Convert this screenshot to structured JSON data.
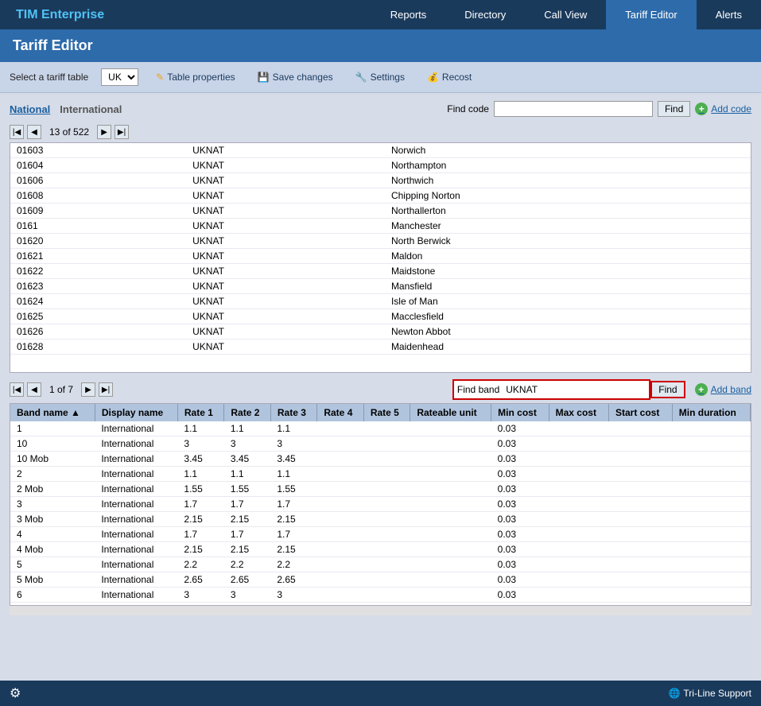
{
  "app": {
    "name_prefix": "TIM",
    "name_suffix": " Enterprise"
  },
  "nav": {
    "items": [
      {
        "label": "Reports",
        "active": false
      },
      {
        "label": "Directory",
        "active": false
      },
      {
        "label": "Call View",
        "active": false
      },
      {
        "label": "Tariff Editor",
        "active": true
      },
      {
        "label": "Alerts",
        "active": false
      }
    ]
  },
  "page_title": "Tariff Editor",
  "toolbar": {
    "select_label": "Select a tariff table",
    "tariff_options": [
      "UK"
    ],
    "tariff_selected": "UK",
    "table_properties": "Table properties",
    "save_changes": "Save changes",
    "settings": "Settings",
    "recost": "Recost"
  },
  "tabs": {
    "national_label": "National",
    "international_label": "International",
    "active": "National"
  },
  "find_code": {
    "label": "Find code",
    "placeholder": "",
    "button": "Find"
  },
  "add_code": {
    "label": "Add code"
  },
  "pagination_top": {
    "current": 13,
    "total": 522
  },
  "codes_table": {
    "rows": [
      {
        "code": "01603",
        "type": "UKNAT",
        "description": "Norwich"
      },
      {
        "code": "01604",
        "type": "UKNAT",
        "description": "Northampton"
      },
      {
        "code": "01606",
        "type": "UKNAT",
        "description": "Northwich"
      },
      {
        "code": "01608",
        "type": "UKNAT",
        "description": "Chipping Norton"
      },
      {
        "code": "01609",
        "type": "UKNAT",
        "description": "Northallerton"
      },
      {
        "code": "0161",
        "type": "UKNAT",
        "description": "Manchester"
      },
      {
        "code": "01620",
        "type": "UKNAT",
        "description": "North Berwick"
      },
      {
        "code": "01621",
        "type": "UKNAT",
        "description": "Maldon"
      },
      {
        "code": "01622",
        "type": "UKNAT",
        "description": "Maidstone"
      },
      {
        "code": "01623",
        "type": "UKNAT",
        "description": "Mansfield"
      },
      {
        "code": "01624",
        "type": "UKNAT",
        "description": "Isle of Man"
      },
      {
        "code": "01625",
        "type": "UKNAT",
        "description": "Macclesfield"
      },
      {
        "code": "01626",
        "type": "UKNAT",
        "description": "Newton Abbot"
      },
      {
        "code": "01628",
        "type": "UKNAT",
        "description": "Maidenhead"
      }
    ]
  },
  "pagination_band": {
    "current": 1,
    "total": 7
  },
  "find_band": {
    "label": "Find band",
    "value": "UKNAT",
    "button": "Find"
  },
  "add_band": {
    "label": "Add band"
  },
  "band_table": {
    "headers": [
      {
        "label": "Band name ▲",
        "sort": true
      },
      {
        "label": "Display name"
      },
      {
        "label": "Rate 1"
      },
      {
        "label": "Rate 2"
      },
      {
        "label": "Rate 3"
      },
      {
        "label": "Rate 4"
      },
      {
        "label": "Rate 5"
      },
      {
        "label": "Rateable unit"
      },
      {
        "label": "Min cost"
      },
      {
        "label": "Max cost"
      },
      {
        "label": "Start cost"
      },
      {
        "label": "Min duration"
      }
    ],
    "rows": [
      {
        "band": "1",
        "display": "International",
        "r1": "1.1",
        "r2": "1.1",
        "r3": "1.1",
        "r4": "",
        "r5": "",
        "rateable": "",
        "min_cost": "0.03",
        "max_cost": "",
        "start_cost": "",
        "min_dur": ""
      },
      {
        "band": "10",
        "display": "International",
        "r1": "3",
        "r2": "3",
        "r3": "3",
        "r4": "",
        "r5": "",
        "rateable": "",
        "min_cost": "0.03",
        "max_cost": "",
        "start_cost": "",
        "min_dur": ""
      },
      {
        "band": "10 Mob",
        "display": "International",
        "r1": "3.45",
        "r2": "3.45",
        "r3": "3.45",
        "r4": "",
        "r5": "",
        "rateable": "",
        "min_cost": "0.03",
        "max_cost": "",
        "start_cost": "",
        "min_dur": ""
      },
      {
        "band": "2",
        "display": "International",
        "r1": "1.1",
        "r2": "1.1",
        "r3": "1.1",
        "r4": "",
        "r5": "",
        "rateable": "",
        "min_cost": "0.03",
        "max_cost": "",
        "start_cost": "",
        "min_dur": ""
      },
      {
        "band": "2 Mob",
        "display": "International",
        "r1": "1.55",
        "r2": "1.55",
        "r3": "1.55",
        "r4": "",
        "r5": "",
        "rateable": "",
        "min_cost": "0.03",
        "max_cost": "",
        "start_cost": "",
        "min_dur": ""
      },
      {
        "band": "3",
        "display": "International",
        "r1": "1.7",
        "r2": "1.7",
        "r3": "1.7",
        "r4": "",
        "r5": "",
        "rateable": "",
        "min_cost": "0.03",
        "max_cost": "",
        "start_cost": "",
        "min_dur": ""
      },
      {
        "band": "3 Mob",
        "display": "International",
        "r1": "2.15",
        "r2": "2.15",
        "r3": "2.15",
        "r4": "",
        "r5": "",
        "rateable": "",
        "min_cost": "0.03",
        "max_cost": "",
        "start_cost": "",
        "min_dur": ""
      },
      {
        "band": "4",
        "display": "International",
        "r1": "1.7",
        "r2": "1.7",
        "r3": "1.7",
        "r4": "",
        "r5": "",
        "rateable": "",
        "min_cost": "0.03",
        "max_cost": "",
        "start_cost": "",
        "min_dur": ""
      },
      {
        "band": "4 Mob",
        "display": "International",
        "r1": "2.15",
        "r2": "2.15",
        "r3": "2.15",
        "r4": "",
        "r5": "",
        "rateable": "",
        "min_cost": "0.03",
        "max_cost": "",
        "start_cost": "",
        "min_dur": ""
      },
      {
        "band": "5",
        "display": "International",
        "r1": "2.2",
        "r2": "2.2",
        "r3": "2.2",
        "r4": "",
        "r5": "",
        "rateable": "",
        "min_cost": "0.03",
        "max_cost": "",
        "start_cost": "",
        "min_dur": ""
      },
      {
        "band": "5 Mob",
        "display": "International",
        "r1": "2.65",
        "r2": "2.65",
        "r3": "2.65",
        "r4": "",
        "r5": "",
        "rateable": "",
        "min_cost": "0.03",
        "max_cost": "",
        "start_cost": "",
        "min_dur": ""
      },
      {
        "band": "6",
        "display": "International",
        "r1": "3",
        "r2": "3",
        "r3": "3",
        "r4": "",
        "r5": "",
        "rateable": "",
        "min_cost": "0.03",
        "max_cost": "",
        "start_cost": "",
        "min_dur": ""
      }
    ]
  },
  "footer": {
    "support_label": "Tri-Line Support"
  }
}
